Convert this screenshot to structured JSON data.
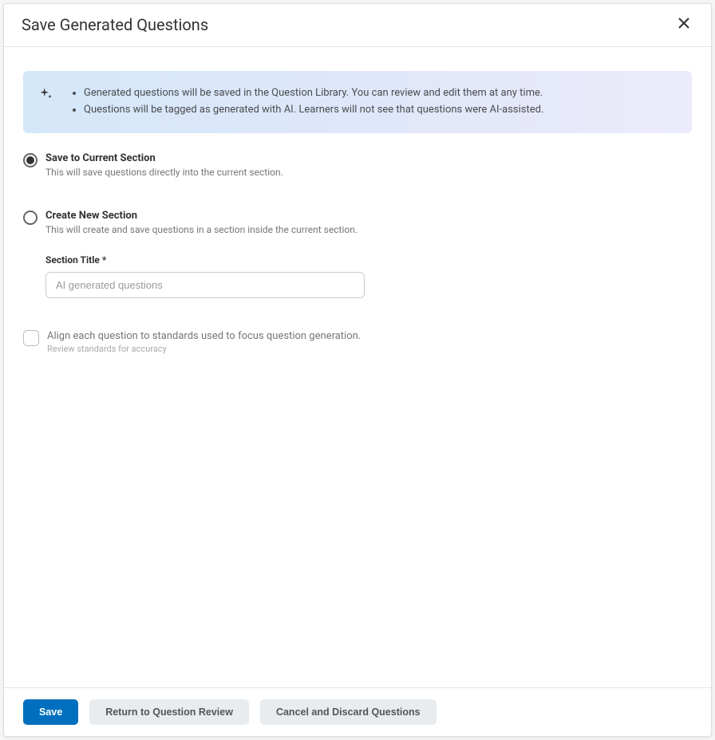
{
  "header": {
    "title": "Save Generated Questions"
  },
  "banner": {
    "items": [
      "Generated questions will be saved in the Question Library. You can review and edit them at any time.",
      "Questions will be tagged as generated with AI. Learners will not see that questions were AI-assisted."
    ]
  },
  "options": {
    "saveCurrent": {
      "label": "Save to Current Section",
      "desc": "This will save questions directly into the current section."
    },
    "createNew": {
      "label": "Create New Section",
      "desc": "This will create and save questions in a section inside the current section.",
      "titleLabel": "Section Title *",
      "titlePlaceholder": "AI generated questions"
    }
  },
  "align": {
    "label": "Align each question to standards used to focus question generation.",
    "desc": "Review standards for accuracy"
  },
  "footer": {
    "save": "Save",
    "return": "Return to Question Review",
    "cancel": "Cancel and Discard Questions"
  }
}
